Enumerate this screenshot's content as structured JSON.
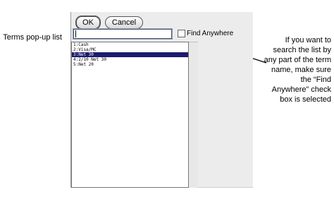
{
  "annotations": {
    "left": "Terms pop-up list",
    "right": "If you want to search the list by any part of the term name, make sure the “Find Anywhere” check box is selected"
  },
  "dialog": {
    "ok_label": "OK",
    "cancel_label": "Cancel",
    "search": {
      "value": "",
      "placeholder": ""
    },
    "find_anywhere": {
      "label": "Find Anywhere",
      "checked": false
    }
  },
  "list": {
    "items": [
      {
        "label": "1:Cash",
        "selected": false
      },
      {
        "label": "2:Visa/MC",
        "selected": false
      },
      {
        "label": "3:Net 30",
        "selected": true
      },
      {
        "label": "4:2/10 Net 30",
        "selected": false
      },
      {
        "label": "5:Net 20",
        "selected": false
      }
    ]
  },
  "colors": {
    "selection": "#1c1b6f",
    "focus_ring": "#8aa4d0"
  }
}
